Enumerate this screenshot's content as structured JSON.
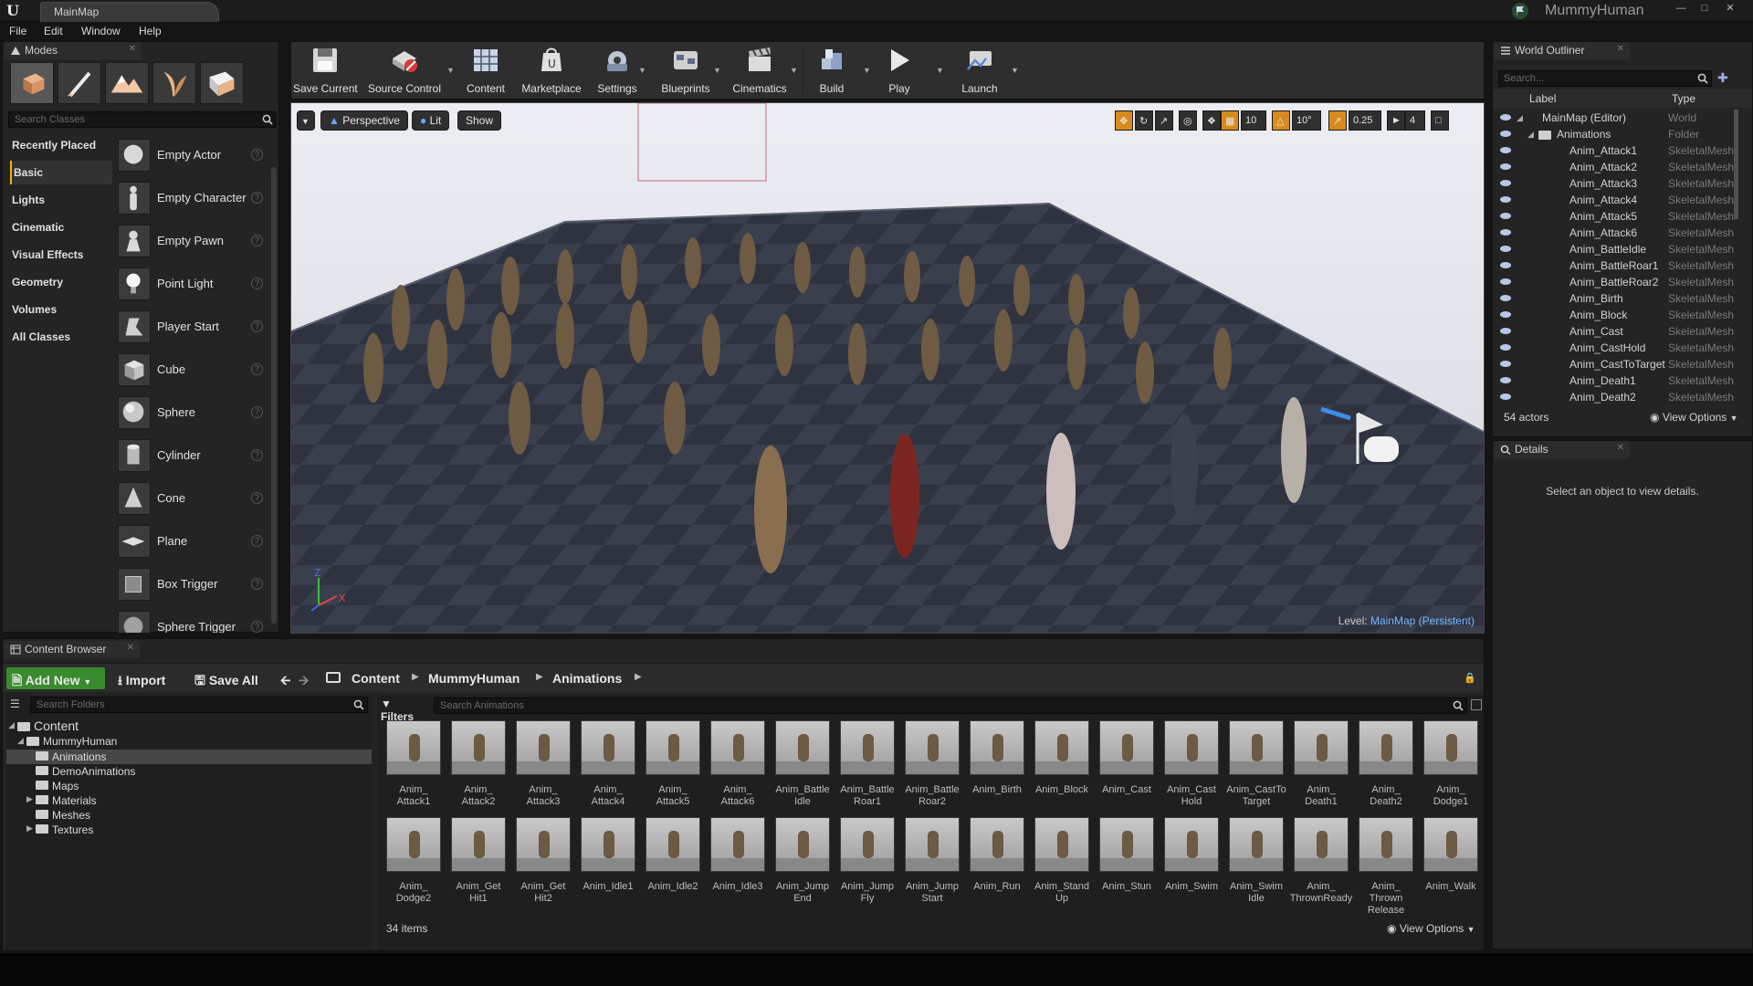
{
  "app": {
    "document_tab": "MainMap",
    "project_name": "MummyHuman",
    "menu": [
      "File",
      "Edit",
      "Window",
      "Help"
    ]
  },
  "colors": {
    "accent_green": "#3a8a2e",
    "selection_orange": "#f7b500",
    "link_blue": "#74b8ff",
    "panel_bg": "#242424"
  },
  "modes": {
    "tab_label": "Modes",
    "mode_icons": [
      "place-mode-icon",
      "paint-mode-icon",
      "landscape-mode-icon",
      "foliage-mode-icon",
      "geometry-mode-icon"
    ],
    "search_placeholder": "Search Classes",
    "categories": [
      "Recently Placed",
      "Basic",
      "Lights",
      "Cinematic",
      "Visual Effects",
      "Geometry",
      "Volumes",
      "All Classes"
    ],
    "active_category": "Basic",
    "actors": [
      "Empty Actor",
      "Empty Character",
      "Empty Pawn",
      "Point Light",
      "Player Start",
      "Cube",
      "Sphere",
      "Cylinder",
      "Cone",
      "Plane",
      "Box Trigger",
      "Sphere Trigger"
    ]
  },
  "toolbar": {
    "buttons": [
      "Save Current",
      "Source Control",
      "Content",
      "Marketplace",
      "Settings",
      "Blueprints",
      "Cinematics",
      "Build",
      "Play",
      "Launch"
    ]
  },
  "viewport": {
    "perspective_label": "Perspective",
    "lit_label": "Lit",
    "show_label": "Show",
    "grid_snap": "10",
    "rotation_snap": "10°",
    "scale_snap": "0.25",
    "camera_speed": "4",
    "level_label": "Level:",
    "level_name": "MainMap (Persistent)",
    "axis_z": "Z",
    "axis_x": "X"
  },
  "outliner": {
    "tab_label": "World Outliner",
    "search_placeholder": "Search...",
    "col_label": "Label",
    "col_type": "Type",
    "rows": [
      {
        "name": "MainMap (Editor)",
        "type": "World",
        "depth": 0
      },
      {
        "name": "Animations",
        "type": "Folder",
        "depth": 1
      },
      {
        "name": "Anim_Attack1",
        "type": "SkeletalMesh",
        "depth": 2
      },
      {
        "name": "Anim_Attack2",
        "type": "SkeletalMesh",
        "depth": 2
      },
      {
        "name": "Anim_Attack3",
        "type": "SkeletalMesh",
        "depth": 2
      },
      {
        "name": "Anim_Attack4",
        "type": "SkeletalMesh",
        "depth": 2
      },
      {
        "name": "Anim_Attack5",
        "type": "SkeletalMesh",
        "depth": 2
      },
      {
        "name": "Anim_Attack6",
        "type": "SkeletalMesh",
        "depth": 2
      },
      {
        "name": "Anim_BattleIdle",
        "type": "SkeletalMesh",
        "depth": 2
      },
      {
        "name": "Anim_BattleRoar1",
        "type": "SkeletalMesh",
        "depth": 2
      },
      {
        "name": "Anim_BattleRoar2",
        "type": "SkeletalMesh",
        "depth": 2
      },
      {
        "name": "Anim_Birth",
        "type": "SkeletalMesh",
        "depth": 2
      },
      {
        "name": "Anim_Block",
        "type": "SkeletalMesh",
        "depth": 2
      },
      {
        "name": "Anim_Cast",
        "type": "SkeletalMesh",
        "depth": 2
      },
      {
        "name": "Anim_CastHold",
        "type": "SkeletalMesh",
        "depth": 2
      },
      {
        "name": "Anim_CastToTarget",
        "type": "SkeletalMesh",
        "depth": 2
      },
      {
        "name": "Anim_Death1",
        "type": "SkeletalMesh",
        "depth": 2
      },
      {
        "name": "Anim_Death2",
        "type": "SkeletalMesh",
        "depth": 2
      }
    ],
    "actor_count": "54 actors",
    "view_options": "View Options"
  },
  "details": {
    "tab_label": "Details",
    "empty_message": "Select an object to view details."
  },
  "content_browser": {
    "tab_label": "Content Browser",
    "add_new": "Add New",
    "import": "Import",
    "save_all": "Save All",
    "breadcrumbs": [
      "Content",
      "MummyHuman",
      "Animations"
    ],
    "folder_search_placeholder": "Search Folders",
    "folders": [
      {
        "name": "Content",
        "depth": 0,
        "expanded": true
      },
      {
        "name": "MummyHuman",
        "depth": 1,
        "expanded": true
      },
      {
        "name": "Animations",
        "depth": 2,
        "selected": true
      },
      {
        "name": "DemoAnimations",
        "depth": 2
      },
      {
        "name": "Maps",
        "depth": 2
      },
      {
        "name": "Materials",
        "depth": 2,
        "collapsed": true
      },
      {
        "name": "Meshes",
        "depth": 2
      },
      {
        "name": "Textures",
        "depth": 2,
        "collapsed": true
      }
    ],
    "filters_label": "Filters",
    "asset_search_placeholder": "Search Animations",
    "assets": [
      "Anim_\nAttack1",
      "Anim_\nAttack2",
      "Anim_\nAttack3",
      "Anim_\nAttack4",
      "Anim_\nAttack5",
      "Anim_\nAttack6",
      "Anim_Battle\nIdle",
      "Anim_Battle\nRoar1",
      "Anim_Battle\nRoar2",
      "Anim_Birth",
      "Anim_Block",
      "Anim_Cast",
      "Anim_Cast\nHold",
      "Anim_CastTo\nTarget",
      "Anim_\nDeath1",
      "Anim_\nDeath2",
      "Anim_\nDodge1",
      "Anim_\nDodge2",
      "Anim_Get\nHit1",
      "Anim_Get\nHit2",
      "Anim_Idle1",
      "Anim_Idle2",
      "Anim_Idle3",
      "Anim_Jump\nEnd",
      "Anim_Jump\nFly",
      "Anim_Jump\nStart",
      "Anim_Run",
      "Anim_Stand\nUp",
      "Anim_Stun",
      "Anim_Swim",
      "Anim_Swim\nIdle",
      "Anim_\nThrownReady",
      "Anim_\nThrown\nRelease",
      "Anim_Walk"
    ],
    "item_count": "34 items",
    "view_options": "View Options"
  }
}
